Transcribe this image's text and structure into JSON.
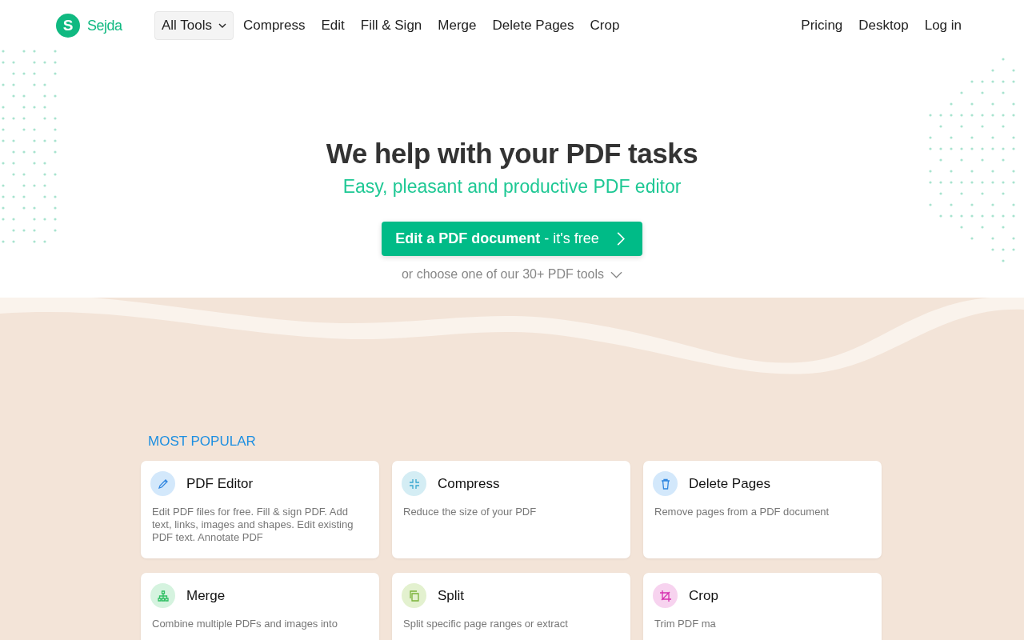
{
  "header": {
    "logo_letter": "S",
    "brand": "Sejda",
    "nav": [
      {
        "label": "All Tools",
        "kind": "dropdown"
      },
      {
        "label": "Compress",
        "kind": "link"
      },
      {
        "label": "Edit",
        "kind": "link"
      },
      {
        "label": "Fill & Sign",
        "kind": "link"
      },
      {
        "label": "Merge",
        "kind": "link"
      },
      {
        "label": "Delete Pages",
        "kind": "link"
      },
      {
        "label": "Crop",
        "kind": "link"
      }
    ],
    "right_links": [
      "Pricing",
      "Desktop",
      "Log in"
    ]
  },
  "hero": {
    "title": "We help with your PDF tasks",
    "subtitle": "Easy, pleasant and productive PDF editor",
    "cta": "**Edit a PDF document** - it's free",
    "more_link": "or choose one of our 30+ PDF tools"
  },
  "section_title": "MOST POPULAR",
  "tools": [
    {
      "name": "PDF Editor",
      "description": "Edit PDF files for free. Fill & sign PDF. Add text, links, images and shapes. Edit existing PDF text. Annotate PDF",
      "kind": "pencil",
      "color": "#d3e8fb"
    },
    {
      "name": "Compress",
      "description": "Reduce the size of your PDF",
      "kind": "compress",
      "color": "#d4edf4"
    },
    {
      "name": "Delete Pages",
      "description": "Remove pages from a PDF document",
      "kind": "trash",
      "color": "#d3e8fb"
    },
    {
      "name": "Merge",
      "description": "Combine multiple PDFs and images into",
      "kind": "merge",
      "color": "#d5f3df"
    },
    {
      "name": "Split",
      "description": "Split specific page ranges or extract",
      "kind": "split",
      "color": "#e3f1cf"
    },
    {
      "name": "Crop",
      "description": "Trim PDF ma",
      "kind": "crop",
      "color": "#f7d3ef"
    }
  ]
}
